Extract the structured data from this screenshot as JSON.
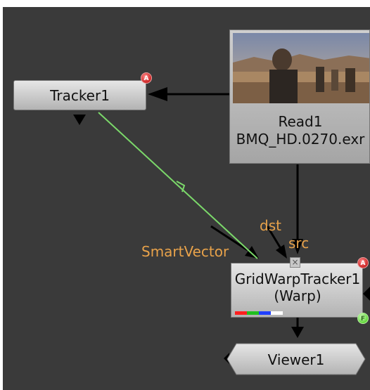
{
  "colors": {
    "graph_background": "#3a3a3a",
    "wire_default": "#000000",
    "wire_tracker_link": "#7bd86a",
    "input_label": "#e8a24a",
    "node_fill_top": "#e6e6e6",
    "node_fill_bottom": "#b3b3b3"
  },
  "nodes": {
    "tracker": {
      "label": "Tracker1",
      "badge": "A"
    },
    "read": {
      "label": "Read1",
      "file": "BMQ_HD.0270.exr",
      "thumbnail": "desert-scene-person-thumbnail"
    },
    "gridwarp": {
      "label": "GridWarpTracker1",
      "subtitle": "(Warp)",
      "badge_top": "A",
      "badge_bottom": "F",
      "channels": [
        "#ff2020",
        "#20c020",
        "#2040ff",
        "#ffffff"
      ]
    },
    "viewer": {
      "label": "Viewer1"
    }
  },
  "inputs": {
    "dst": "dst",
    "src": "src",
    "smartvector": "SmartVector",
    "handle_symbol": "×"
  }
}
